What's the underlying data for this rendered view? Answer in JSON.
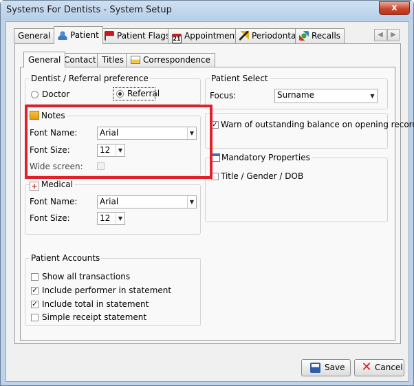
{
  "window": {
    "title": "Systems For Dentists - System Setup",
    "close_glyph": "x"
  },
  "top_tabs": [
    {
      "label": "General",
      "active": false
    },
    {
      "label": "Patient",
      "active": true,
      "icon": "patient-icon"
    },
    {
      "label": "Patient Flags",
      "active": false,
      "icon": "flag-icon"
    },
    {
      "label": "Appointments",
      "active": false,
      "icon": "calendar-icon",
      "icon_text": "21"
    },
    {
      "label": "Periodontal",
      "active": false,
      "icon": "periodontal-icon"
    },
    {
      "label": "Recalls",
      "active": false,
      "icon": "recalls-icon"
    }
  ],
  "tab_scroll": {
    "left": "◀",
    "right": "▶"
  },
  "inner_tabs": [
    {
      "label": "General",
      "active": true
    },
    {
      "label": "Contact",
      "active": false
    },
    {
      "label": "Titles",
      "active": false
    },
    {
      "label": "Correspondence",
      "active": false,
      "icon": "correspondence-icon"
    }
  ],
  "dentist_pref": {
    "legend": "Dentist / Referral preference",
    "options": [
      {
        "label": "Doctor",
        "selected": false
      },
      {
        "label": "Referral",
        "selected": true
      }
    ]
  },
  "notes": {
    "legend": "Notes",
    "icon": "notes-icon",
    "font_name_label": "Font Name:",
    "font_name_value": "Arial",
    "font_size_label": "Font Size:",
    "font_size_value": "12",
    "wide_screen_label": "Wide screen:",
    "wide_screen_checked": false
  },
  "medical": {
    "legend": "Medical",
    "icon": "medical-icon",
    "font_name_label": "Font Name:",
    "font_name_value": "Arial",
    "font_size_label": "Font Size:",
    "font_size_value": "12"
  },
  "patient_accounts": {
    "legend": "Patient Accounts",
    "items": [
      {
        "label": "Show all transactions",
        "checked": false
      },
      {
        "label": "Include performer in statement",
        "checked": true
      },
      {
        "label": "Include total in statement",
        "checked": true
      },
      {
        "label": "Simple receipt statement",
        "checked": false
      }
    ]
  },
  "patient_select": {
    "legend": "Patient Select",
    "focus_label": "Focus:",
    "focus_value": "Surname"
  },
  "warn_balance": {
    "label": "Warn of outstanding balance on opening record",
    "checked": true
  },
  "mandatory": {
    "legend": "Mandatory Properties",
    "icon": "mandatory-properties-icon",
    "items": [
      {
        "label": "Title / Gender / DOB",
        "checked": false
      }
    ]
  },
  "buttons": {
    "save": "Save",
    "cancel": "Cancel"
  },
  "colors": {
    "highlight": "#e0202a",
    "title_bar": "#bcd3ea"
  }
}
